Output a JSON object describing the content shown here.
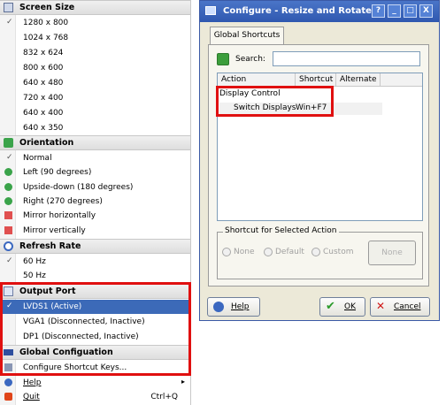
{
  "menu": {
    "screen_size": {
      "header": "Screen Size",
      "items": [
        "1280 x 800",
        "1024 x 768",
        "832 x 624",
        "800 x 600",
        "640 x 480",
        "720 x 400",
        "640 x 400",
        "640 x 350"
      ],
      "checked": "1280 x 800"
    },
    "orientation": {
      "header": "Orientation",
      "items": [
        "Normal",
        "Left (90 degrees)",
        "Upside-down (180 degrees)",
        "Right (270 degrees)",
        "Mirror horizontally",
        "Mirror vertically"
      ]
    },
    "refresh_rate": {
      "header": "Refresh Rate",
      "items": [
        "60 Hz",
        "50 Hz"
      ]
    },
    "output_port": {
      "header": "Output Port",
      "items": [
        "LVDS1 (Active)",
        "VGA1 (Disconnected, Inactive)",
        "DP1 (Disconnected, Inactive)"
      ]
    },
    "global_config": {
      "header": "Global Configuation",
      "items": [
        "Configure Shortcut Keys..."
      ]
    },
    "help": "Help",
    "quit": "Quit",
    "quit_shortcut": "Ctrl+Q",
    "check_mark": "✓"
  },
  "dialog": {
    "title": "Configure - Resize and Rotate",
    "title_buttons": [
      "?",
      "_",
      "□",
      "X"
    ],
    "tab": "Global Shortcuts",
    "search_label": "Search:",
    "search_value": "",
    "columns": [
      "Action",
      "Shortcut",
      "Alternate"
    ],
    "tree": {
      "group": "Display Control",
      "row": {
        "action": "Switch Displays",
        "shortcut": "Win+F7",
        "alternate": ""
      }
    },
    "shortcut_group": {
      "legend": "Shortcut for Selected Action",
      "options": [
        "None",
        "Default",
        "Custom"
      ],
      "key_button": "None"
    },
    "help_button": "Help",
    "ok_button": "OK",
    "cancel_button": "Cancel"
  },
  "colors": {
    "highlight": "#3c6ab8",
    "annotation": "#e01010",
    "titlebar": "#2f58b0",
    "dialog_bg": "#ece9d8"
  }
}
